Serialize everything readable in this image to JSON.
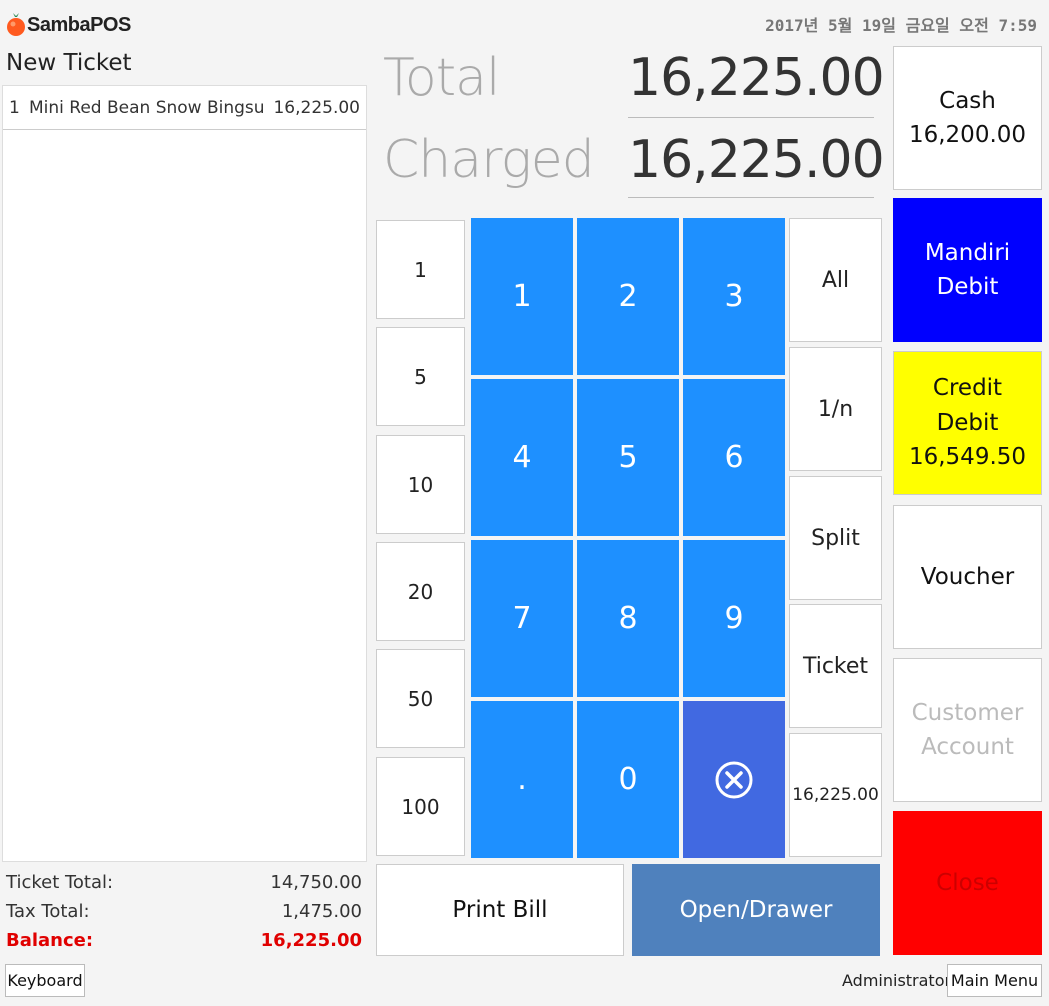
{
  "header": {
    "logo_text": "SambaPOS",
    "datetime": "2017년 5월 19일 금요일 오전 7:59"
  },
  "ticket": {
    "title": "New Ticket",
    "orders": [
      {
        "qty": "1",
        "name": "Mini Red Bean Snow Bingsu",
        "price": "16,225.00"
      }
    ],
    "ticket_total_label": "Ticket Total:",
    "ticket_total_value": "14,750.00",
    "tax_total_label": "Tax Total:",
    "tax_total_value": "1,475.00",
    "balance_label": "Balance:",
    "balance_value": "16,225.00"
  },
  "amounts": {
    "total_label": "Total",
    "total_value": "16,225.00",
    "charged_label": "Charged",
    "charged_value": "16,225.00"
  },
  "quick_tenders": [
    "1",
    "5",
    "10",
    "20",
    "50",
    "100"
  ],
  "numpad": [
    "1",
    "2",
    "3",
    "4",
    "5",
    "6",
    "7",
    "8",
    "9",
    ".",
    "0"
  ],
  "split_options": [
    "All",
    "1/n",
    "Split",
    "Ticket",
    "16,225.00"
  ],
  "actions": {
    "print_bill": "Print Bill",
    "open_drawer": "Open/Drawer"
  },
  "payments": {
    "cash_label": "Cash",
    "cash_amount": "16,200.00",
    "mandiri_line1": "Mandiri",
    "mandiri_line2": "Debit",
    "credit_line1": "Credit",
    "credit_line2": "Debit",
    "credit_amount": "16,549.50",
    "voucher": "Voucher",
    "customer_line1": "Customer",
    "customer_line2": "Account",
    "close": "Close"
  },
  "footer": {
    "keyboard": "Keyboard",
    "user": "Administrator",
    "main_menu": "Main Menu"
  },
  "colors": {
    "numpad": "#1e90ff",
    "delete_key": "#4169e1",
    "open_drawer": "#4f81bd",
    "mandiri": "#0000ff",
    "credit": "#ffff00",
    "close": "#ff0000",
    "balance_text": "#e00000"
  }
}
